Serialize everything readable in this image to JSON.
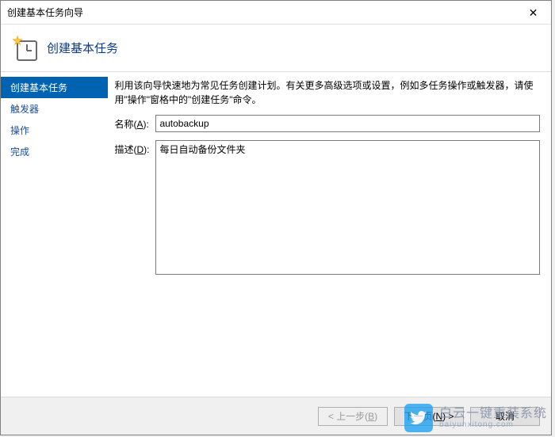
{
  "window": {
    "title": "创建基本任务向导"
  },
  "banner": {
    "heading": "创建基本任务"
  },
  "sidebar": {
    "items": [
      {
        "label": "创建基本任务",
        "active": true
      },
      {
        "label": "触发器",
        "active": false
      },
      {
        "label": "操作",
        "active": false
      },
      {
        "label": "完成",
        "active": false
      }
    ]
  },
  "content": {
    "intro": "利用该向导快速地为常见任务创建计划。有关更多高级选项或设置，例如多任务操作或触发器，请使用\"操作\"窗格中的\"创建任务\"命令。",
    "name_label_prefix": "名称(",
    "name_label_key": "A",
    "name_label_suffix": "):",
    "name_value": "autobackup",
    "desc_label_prefix": "描述(",
    "desc_label_key": "D",
    "desc_label_suffix": "):",
    "desc_value": "每日自动备份文件夹"
  },
  "footer": {
    "back_prefix": "< 上一步(",
    "back_key": "B",
    "back_suffix": ")",
    "next_prefix": "下一页(",
    "next_key": "N",
    "next_suffix": ") >",
    "cancel": "取消"
  },
  "watermark": {
    "line1": "白云一键重装系统",
    "line2": "baiyunxitong.com"
  }
}
